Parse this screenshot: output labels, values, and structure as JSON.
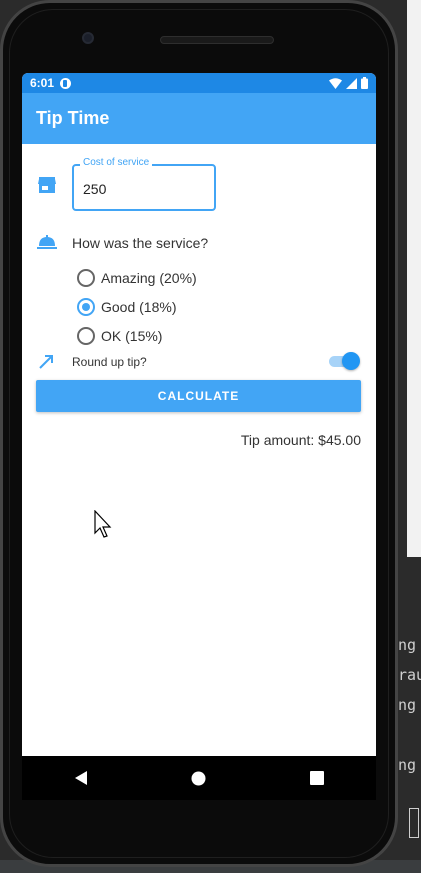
{
  "status_bar": {
    "time": "6:01"
  },
  "app": {
    "title": "Tip Time"
  },
  "cost_field": {
    "label": "Cost of service",
    "value": "250"
  },
  "service": {
    "question": "How was the service?",
    "options": [
      {
        "label": "Amazing (20%)",
        "selected": false
      },
      {
        "label": "Good (18%)",
        "selected": true
      },
      {
        "label": "OK (15%)",
        "selected": false
      }
    ]
  },
  "round_up": {
    "label": "Round up tip?",
    "on": true
  },
  "calculate_button": {
    "label": "CALCULATE"
  },
  "result": {
    "text": "Tip amount: $45.00"
  },
  "ide_fragments": [
    "ng",
    "rau",
    "ng",
    "ng"
  ],
  "colors": {
    "status_bar": "#1e88e5",
    "app_bar": "#42a5f5",
    "accent": "#2196f3"
  },
  "icons": [
    "store-icon",
    "room-service-icon",
    "trending-up-icon",
    "wifi-icon",
    "signal-icon",
    "battery-icon",
    "back-icon",
    "home-icon",
    "recents-icon",
    "mouse-cursor-icon"
  ]
}
